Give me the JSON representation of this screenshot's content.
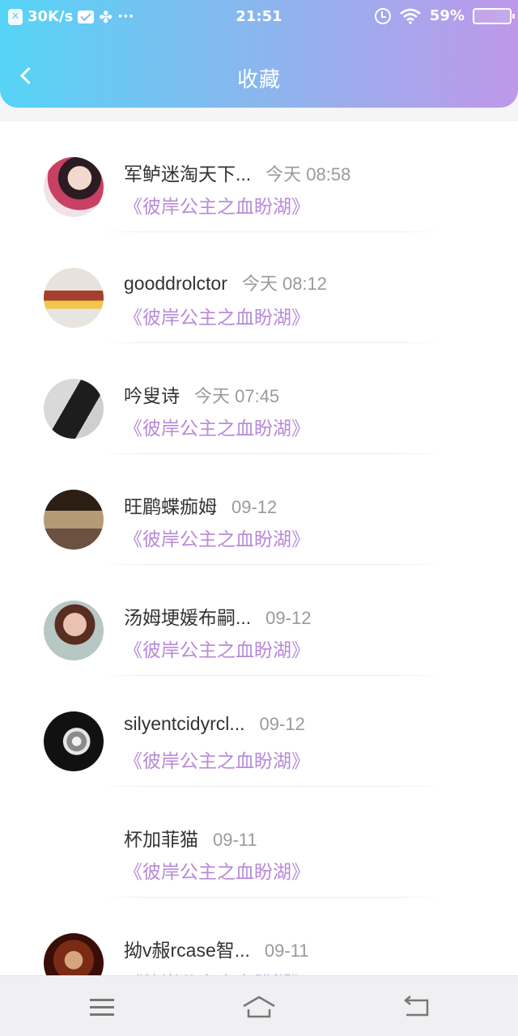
{
  "status_bar": {
    "network_speed": "30K/s",
    "more": "···",
    "time": "21:51",
    "battery": "59%",
    "battery_level": 0.59
  },
  "header": {
    "title": "收藏"
  },
  "items": [
    {
      "name": "军鲈迷淘天下...",
      "time": "今天 08:58",
      "title": "《彼岸公主之血盼湖》"
    },
    {
      "name": "gooddrolctor",
      "time": "今天 08:12",
      "title": "《彼岸公主之血盼湖》"
    },
    {
      "name": "吟叟诗",
      "time": "今天 07:45",
      "title": "《彼岸公主之血盼湖》"
    },
    {
      "name": "旺鹛蝶痂姆",
      "time": "09-12",
      "title": "《彼岸公主之血盼湖》"
    },
    {
      "name": "汤姆埂媛布嗣...",
      "time": "09-12",
      "title": "《彼岸公主之血盼湖》"
    },
    {
      "name": "silyentcidyrcl...",
      "time": "09-12",
      "title": "《彼岸公主之血盼湖》"
    },
    {
      "name": "杯加菲猫",
      "time": "09-11",
      "title": "《彼岸公主之血盼湖》"
    },
    {
      "name": "拗v赧rcase智...",
      "time": "09-11",
      "title": "《彼岸公主之血盼湖》"
    }
  ],
  "colors": {
    "header_gradient_start": "#55d4f6",
    "header_gradient_end": "#bf98ea",
    "title_purple": "#b88ad8"
  }
}
